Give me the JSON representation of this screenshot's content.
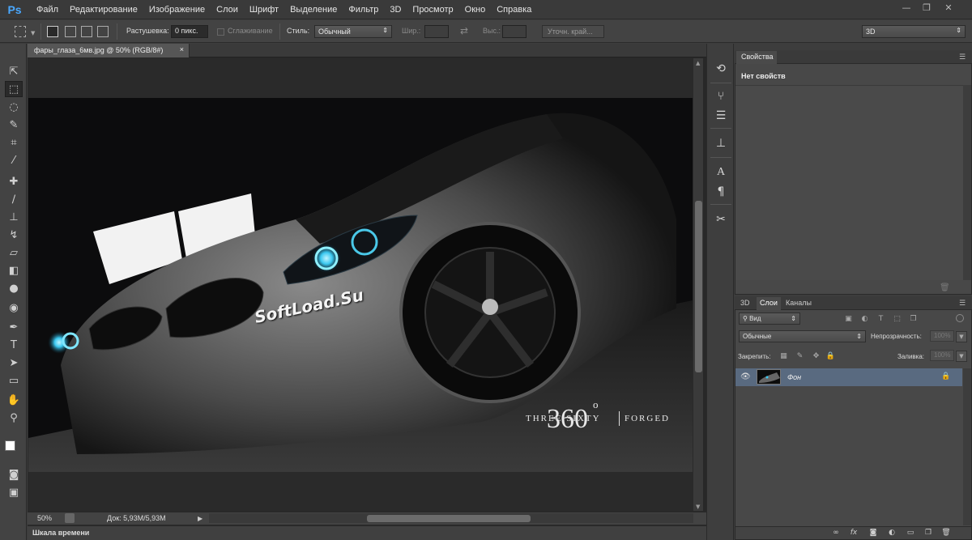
{
  "app": {
    "logo": "Ps"
  },
  "menu": [
    "Файл",
    "Редактирование",
    "Изображение",
    "Слои",
    "Шрифт",
    "Выделение",
    "Фильтр",
    "3D",
    "Просмотр",
    "Окно",
    "Справка"
  ],
  "window_controls": {
    "minimize": "—",
    "restore": "❐",
    "close": "✕"
  },
  "options": {
    "feather_label": "Растушевка:",
    "feather_value": "0 пикс.",
    "antialias_label": "Сглаживание",
    "style_label": "Стиль:",
    "style_value": "Обычный",
    "width_label": "Шир.:",
    "height_label": "Выс.:",
    "refine_edge": "Уточн. край...",
    "workspace": "3D"
  },
  "document": {
    "tab_title": "фары_глаза_6мв.jpg @ 50% (RGB/8#)",
    "tab_close": "×",
    "watermark": "SoftLoad.Su",
    "brand_number": "360",
    "brand_degree": "o",
    "brand_left": "THREE SIXTY",
    "brand_right": "FORGED"
  },
  "status": {
    "zoom": "50%",
    "doc_info": "Док: 5,93M/5,93M"
  },
  "timeline": {
    "label": "Шкала времени"
  },
  "properties": {
    "tab": "Свойства",
    "title": "Нет свойств"
  },
  "layers": {
    "tabs": [
      "3D",
      "Слои",
      "Каналы"
    ],
    "filter": "Вид",
    "blend": "Обычные",
    "opacity_label": "Непрозрачность:",
    "opacity_value": "100%",
    "lock_label": "Закрепить:",
    "fill_label": "Заливка:",
    "fill_value": "100%",
    "layer_name": "Фон"
  },
  "colors": {
    "accent": "#4aa8ff",
    "selected_layer": "#596a80",
    "headlight": "#3ac8f0"
  }
}
